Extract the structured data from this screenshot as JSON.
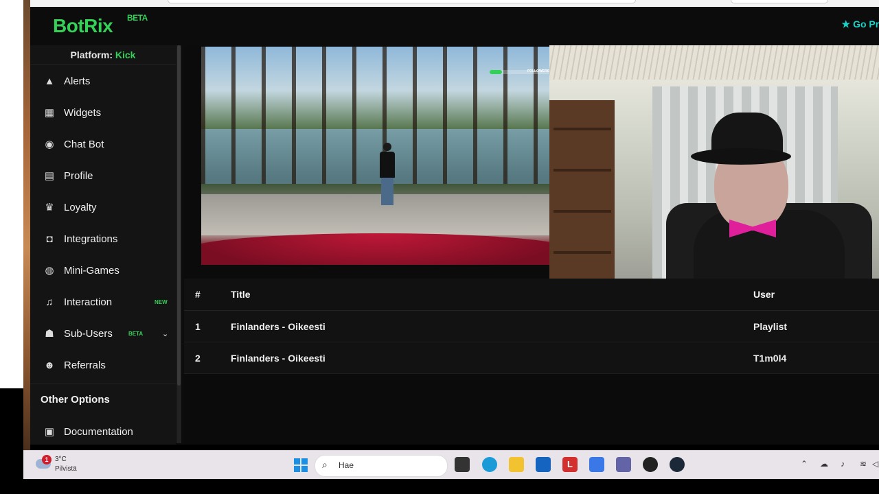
{
  "app": {
    "logo": "BotRix",
    "logo_badge": "BETA",
    "go_premium": "Go Pre"
  },
  "sidebar": {
    "platform_label": "Platform:",
    "platform_value": "Kick",
    "items": [
      {
        "label": "Alerts",
        "icon": "warning-icon",
        "glyph": "▲"
      },
      {
        "label": "Widgets",
        "icon": "grid-icon",
        "glyph": "▦"
      },
      {
        "label": "Chat Bot",
        "icon": "robot-icon",
        "glyph": "◉"
      },
      {
        "label": "Profile",
        "icon": "id-card-icon",
        "glyph": "▤"
      },
      {
        "label": "Loyalty",
        "icon": "trophy-icon",
        "glyph": "♛"
      },
      {
        "label": "Integrations",
        "icon": "chat-bubble-icon",
        "glyph": "◘"
      },
      {
        "label": "Mini-Games",
        "icon": "gamepad-icon",
        "glyph": "◍"
      },
      {
        "label": "Interaction",
        "icon": "music-note-icon",
        "glyph": "♫",
        "badge": "NEW"
      },
      {
        "label": "Sub-Users",
        "icon": "users-icon",
        "glyph": "☗",
        "badge": "BETA"
      },
      {
        "label": "Referrals",
        "icon": "user-group-icon",
        "glyph": "☻"
      }
    ],
    "other_options": "Other Options",
    "documentation": {
      "label": "Documentation",
      "icon": "book-icon",
      "glyph": "▣"
    }
  },
  "overlay": {
    "followers_label": "FOLLOWERS"
  },
  "table": {
    "headers": {
      "idx": "#",
      "title": "Title",
      "user": "User"
    },
    "rows": [
      {
        "idx": "1",
        "title": "Finlanders - Oikeesti",
        "user": "Playlist"
      },
      {
        "idx": "2",
        "title": "Finlanders - Oikeesti",
        "user": "T1m0l4"
      }
    ]
  },
  "taskbar": {
    "weather_temp": "3°C",
    "weather_desc": "Pilvistä",
    "weather_alert": "1",
    "search_placeholder": "Hae"
  },
  "colors": {
    "accent": "#34d058",
    "premium": "#18d4c8",
    "background": "#0c0c0c",
    "sidebar": "#141414"
  }
}
